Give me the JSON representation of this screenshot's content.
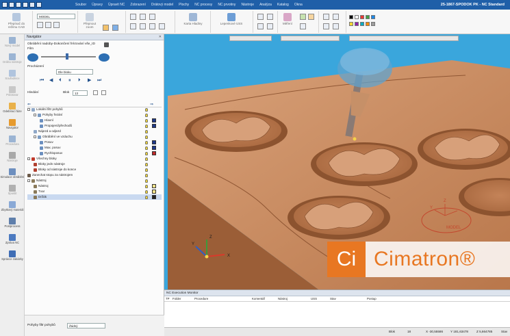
{
  "window": {
    "title": "25-1867-SPODOK PK - NC Standard"
  },
  "menu": [
    "Soubor",
    "Úpravy",
    "Úpravit NC",
    "Zobrazení",
    "Drátový model",
    "Plochy",
    "NC procesy",
    "NC prvotiny",
    "Nástroje",
    "Analýza",
    "Katalog",
    "Okna"
  ],
  "ribbon": {
    "model_combo": "MODEL",
    "buttons": [
      "Přepínač do režimu CAD",
      "Přepnout zoom",
      "Karta Hladiny",
      "Lepenkové USS",
      "Měření"
    ]
  },
  "leftbar": [
    {
      "label": "Nový model",
      "dim": true
    },
    {
      "label": "Dráha nástroje",
      "dim": true
    },
    {
      "label": "Souřadnice",
      "dim": true
    },
    {
      "label": "Polotovar",
      "dim": true
    },
    {
      "label": "Odebírací fáze",
      "dim": false
    },
    {
      "label": "Navigátor",
      "dim": false
    },
    {
      "label": "Procedura",
      "dim": true
    },
    {
      "label": "Nástroje",
      "dim": true
    },
    {
      "label": "Simulace obrábění",
      "dim": false
    },
    {
      "label": "Spustit",
      "dim": true
    },
    {
      "label": "Zbytkový materiál",
      "dim": false
    },
    {
      "label": "Postprocess",
      "dim": false
    },
    {
      "label": "Zpráva NC",
      "dim": false
    },
    {
      "label": "Správce zakázky",
      "dim": false
    }
  ],
  "navigator": {
    "title": "Navigátor",
    "breadcrumb": "Obrábění nadoby-Dokončení frézování vše_ID",
    "film_label": "Film",
    "speed_label": "Procházení",
    "speed_value": "Dle bloku",
    "step_label": "Hledání",
    "block_label": "Blok",
    "block_value": "13",
    "tree": [
      {
        "label": "Lokální filtr pohybů",
        "indent": 0,
        "exp": true
      },
      {
        "label": "Pohyby řezání",
        "indent": 1,
        "exp": true
      },
      {
        "label": "Hlavní",
        "indent": 2
      },
      {
        "label": "Propojení/přechodů",
        "indent": 2
      },
      {
        "label": "Nájezd a odjezd",
        "indent": 1
      },
      {
        "label": "Obrábění ve vzduchu",
        "indent": 1,
        "exp": true
      },
      {
        "label": "Posuv",
        "indent": 2
      },
      {
        "label": "Max. posuv",
        "indent": 2
      },
      {
        "label": "Rychloposuv",
        "indent": 2
      },
      {
        "label": "Všechny bloky",
        "indent": 0,
        "exp": true
      },
      {
        "label": "Bloky jedn nástroje",
        "indent": 1
      },
      {
        "label": "Bloky od nástroje do konce",
        "indent": 1
      },
      {
        "label": "Zanechat stopu za nástrojem",
        "indent": 0
      },
      {
        "label": "Nástroj",
        "indent": 0,
        "exp": true
      },
      {
        "label": "Nástroj",
        "indent": 1
      },
      {
        "label": "Tvar",
        "indent": 1
      },
      {
        "label": "Držák",
        "indent": 1
      }
    ],
    "footer_label": "Pohyby filtr pohybů",
    "footer_value": "Žádný"
  },
  "viewport": {
    "watermark_badge": "Ci",
    "watermark_text": "Cimatron®",
    "axis_x": "X",
    "axis_y": "Y",
    "axis_z": "Z",
    "model_label": "MODEL"
  },
  "monitor": {
    "title": "NC Execution Monitor",
    "columns": [
      "TP",
      "Folder",
      "Procedure",
      "Komentář",
      "Nástroj",
      "USS",
      "Stav",
      "Postup"
    ]
  },
  "status": {
    "block_label": "Blok",
    "block_value": "18",
    "x": "X -30,55586",
    "y": "Y 181,63478",
    "z": "Z 5,664785",
    "mode": "Stav"
  },
  "colors": {
    "title_blue": "#1f5fa8",
    "viewport_blue": "#3aa6dc",
    "part_copper": "#c98a5e",
    "accent_orange": "#e87722"
  }
}
